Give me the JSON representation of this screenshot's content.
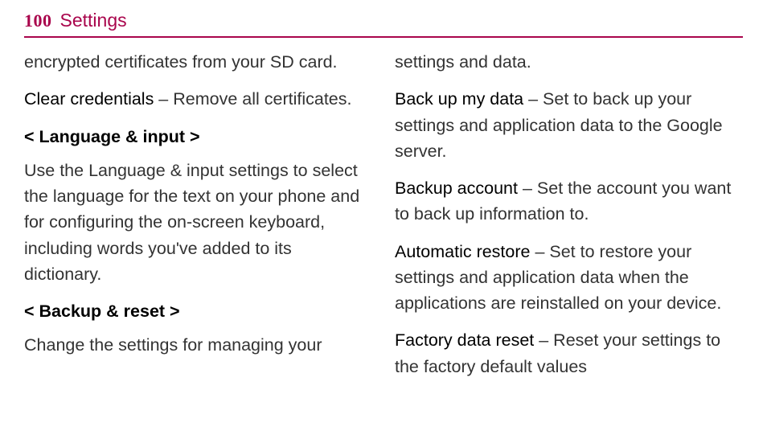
{
  "header": {
    "page_number": "100",
    "title": "Settings"
  },
  "left_column": {
    "para1": "encrypted certificates from your SD card.",
    "clear_credentials_term": "Clear credentials",
    "clear_credentials_desc": " – Remove all certificates.",
    "section1_head": "< Language & input >",
    "section1_body": "Use the Language & input settings to select the language for the text on your phone and for configuring the on-screen keyboard, including words you've added to its dictionary.",
    "section2_head": "< Backup & reset >",
    "section2_body": "Change the settings for managing your"
  },
  "right_column": {
    "para1": "settings and data.",
    "backup_data_term": "Back up my data",
    "backup_data_desc": " – Set to back up your settings and application data to the Google server.",
    "backup_account_term": "Backup account",
    "backup_account_desc": " – Set the account you want to back up information to.",
    "auto_restore_term": "Automatic restore",
    "auto_restore_desc": " – Set to restore your settings and application data when the applications are reinstalled on your device.",
    "factory_reset_term": "Factory data reset",
    "factory_reset_desc": " – Reset your settings to the factory default values"
  }
}
